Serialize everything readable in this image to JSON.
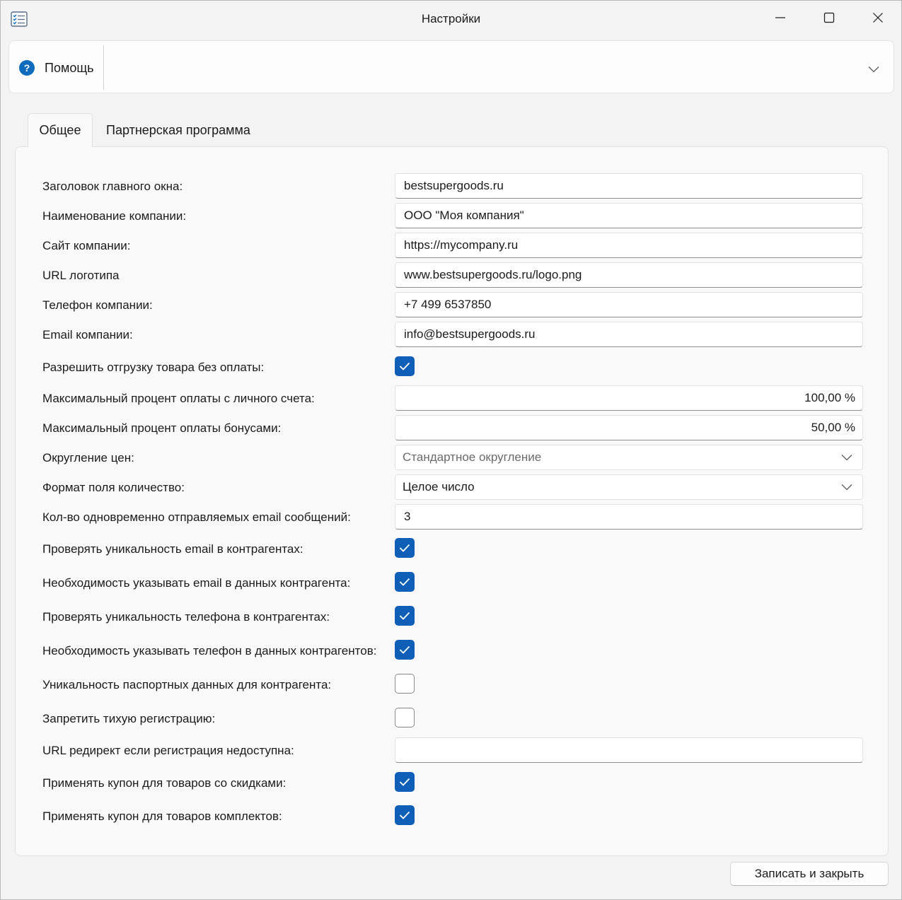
{
  "window": {
    "title": "Настройки"
  },
  "help": {
    "label": "Помощь"
  },
  "tabs": [
    {
      "label": "Общее",
      "active": true
    },
    {
      "label": "Партнерская программа",
      "active": false
    }
  ],
  "form": {
    "window_title": {
      "label": "Заголовок главного окна:",
      "value": "bestsupergoods.ru"
    },
    "company_name": {
      "label": "Наименование компании:",
      "value": "ООО \"Моя компания\""
    },
    "company_site": {
      "label": "Сайт компании:",
      "value": "https://mycompany.ru"
    },
    "logo_url": {
      "label": "URL логотипа",
      "value": "www.bestsupergoods.ru/logo.png"
    },
    "company_phone": {
      "label": "Телефон компании:",
      "value": "+7 499 6537850"
    },
    "company_email": {
      "label": "Email компании:",
      "value": "info@bestsupergoods.ru"
    },
    "allow_unpaid_shipping": {
      "label": "Разрешить отгрузку товара без оплаты:",
      "checked": true
    },
    "max_account_pct": {
      "label": "Максимальный процент оплаты с личного счета:",
      "value": "100,00 %"
    },
    "max_bonus_pct": {
      "label": "Максимальный процент оплаты бонусами:",
      "value": "50,00 %"
    },
    "price_rounding": {
      "label": "Округление цен:",
      "value": "Стандартное округление"
    },
    "qty_format": {
      "label": "Формат поля количество:",
      "value": "Целое число"
    },
    "email_batch": {
      "label": "Кол-во одновременно отправляемых email сообщений:",
      "value": "3"
    },
    "check_email_unique": {
      "label": "Проверять уникальность email в контрагентах:",
      "checked": true
    },
    "require_email": {
      "label": "Необходимость указывать email в данных контрагента:",
      "checked": true
    },
    "check_phone_unique": {
      "label": "Проверять уникальность телефона в контрагентах:",
      "checked": true
    },
    "require_phone": {
      "label": "Необходимость указывать телефон в данных контрагентов:",
      "checked": true
    },
    "passport_unique": {
      "label": "Уникальность паспортных данных для контрагента:",
      "checked": false
    },
    "forbid_silent_reg": {
      "label": "Запретить тихую регистрацию:",
      "checked": false
    },
    "redirect_url": {
      "label": "URL редирект если регистрация недоступна:",
      "value": ""
    },
    "coupon_discounted": {
      "label": "Применять купон для товаров со скидками:",
      "checked": true
    },
    "coupon_bundles": {
      "label": "Применять купон для товаров комплектов:",
      "checked": true
    }
  },
  "buttons": {
    "save_close": "Записать и закрыть"
  },
  "colors": {
    "accent": "#0f5fb8",
    "help_icon": "#0f6cbd"
  },
  "icons": {
    "app": "checklist-icon",
    "help": "question-circle-icon",
    "minimize": "minimize-icon",
    "maximize": "maximize-icon",
    "close": "close-icon",
    "expand": "chevron-down-icon",
    "check": "checkmark-icon"
  }
}
